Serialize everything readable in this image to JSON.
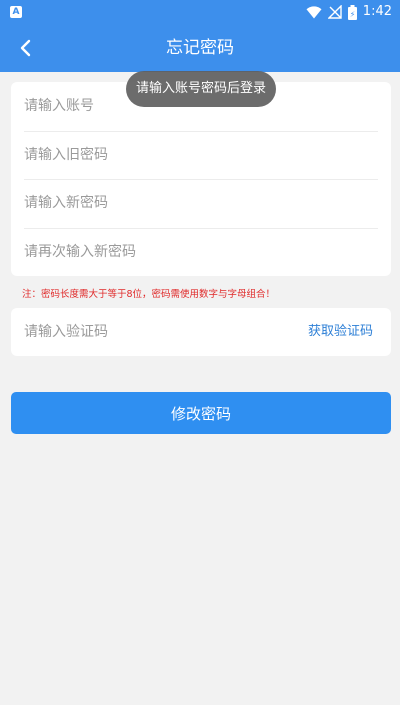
{
  "status_bar": {
    "app_icon_letter": "A",
    "time": "1:42",
    "battery_glyph": "⚡"
  },
  "header": {
    "title": "忘记密码"
  },
  "form": {
    "account_placeholder": "请输入账号",
    "old_password_placeholder": "请输入旧密码",
    "new_password_placeholder": "请输入新密码",
    "confirm_password_placeholder": "请再次输入新密码",
    "note": "注：密码长度需大于等于8位，密码需使用数字与字母组合！",
    "code_placeholder": "请输入验证码",
    "get_code_label": "获取验证码",
    "submit_label": "修改密码"
  },
  "toast": {
    "text": "请输入账号密码后登录"
  },
  "colors": {
    "primary": "#3d8fec",
    "button": "#2f8ff1",
    "link": "#2d7fd6",
    "warning": "#e02a2a",
    "background": "#f2f2f2"
  }
}
